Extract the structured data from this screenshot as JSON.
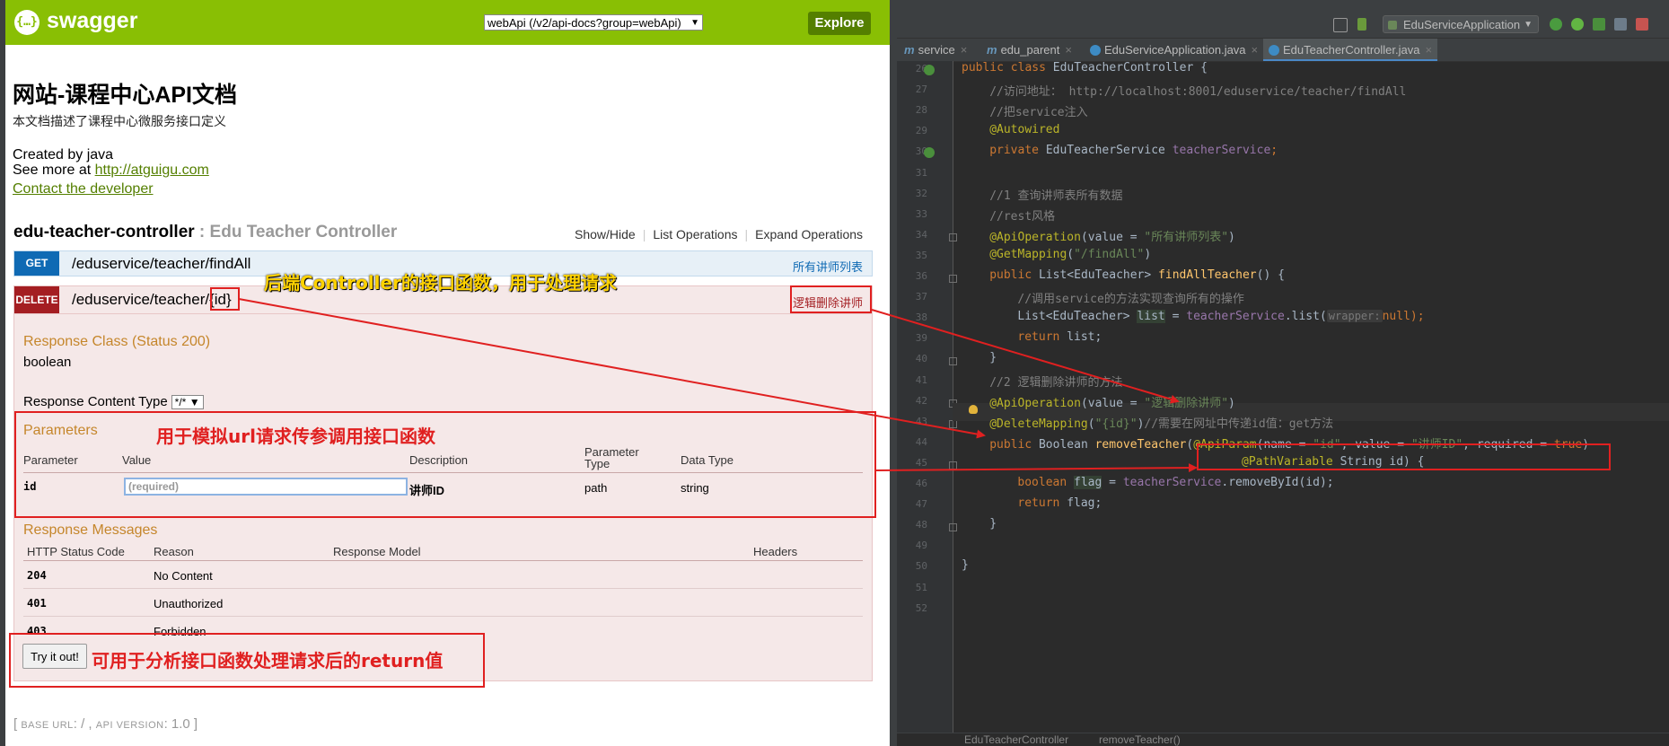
{
  "swagger": {
    "brand": "swagger",
    "logo_text": "{…}",
    "spec_select": "webApi (/v2/api-docs?group=webApi)",
    "explore_label": "Explore",
    "title": "网站-课程中心API文档",
    "description": "本文档描述了课程中心微服务接口定义",
    "created_by": "Created by java",
    "see_more_prefix": "See more at ",
    "see_more_link": "http://atguigu.com",
    "contact": "Contact the developer",
    "controller": {
      "name": "edu-teacher-controller",
      "desc": " : Edu Teacher Controller",
      "links": [
        "Show/Hide",
        "List Operations",
        "Expand Operations"
      ]
    },
    "op_get": {
      "method": "GET",
      "path": "/eduservice/teacher/findAll",
      "summary": "所有讲师列表"
    },
    "op_delete": {
      "method": "DELETE",
      "path_prefix": "/eduservice/teacher/",
      "path_param": "{id}",
      "summary": "逻辑删除讲师",
      "response_class_title": "Response Class (Status 200)",
      "response_class_type": "boolean",
      "response_content_type_label": "Response Content Type",
      "response_content_type_value": "*/*",
      "parameters_title": "Parameters",
      "param_headers": [
        "Parameter",
        "Value",
        "Description",
        "Parameter Type",
        "Data Type"
      ],
      "param_row": {
        "name": "id",
        "placeholder": "(required)",
        "description": "讲师ID",
        "type": "path",
        "data_type": "string"
      },
      "response_messages_title": "Response Messages",
      "msg_headers": [
        "HTTP Status Code",
        "Reason",
        "Response Model",
        "Headers"
      ],
      "msg_rows": [
        {
          "code": "204",
          "reason": "No Content"
        },
        {
          "code": "401",
          "reason": "Unauthorized"
        },
        {
          "code": "403",
          "reason": "Forbidden"
        }
      ],
      "try_label": "Try it out!"
    },
    "base_url_label": "BASE URL",
    "base_url_value": ": / , ",
    "api_version_label": "API VERSION",
    "api_version_value": ": 1.0 ]"
  },
  "annotations": {
    "controller_note": "后端Controller的接口函数，用于处理请求",
    "params_note": "用于模拟url请求传参调用接口函数",
    "try_note": "可用于分析接口函数处理请求后的return值",
    "color": "#e02020",
    "text_color": "#ffd200"
  },
  "ide": {
    "run_config": "EduServiceApplication",
    "tabs": [
      {
        "icon": "m",
        "label": "service"
      },
      {
        "icon": "m",
        "label": "edu_parent"
      },
      {
        "icon": "c",
        "label": "EduServiceApplication.java"
      },
      {
        "icon": "c",
        "label": "EduTeacherController.java"
      }
    ],
    "line_numbers": [
      "26",
      "27",
      "28",
      "29",
      "30",
      "31",
      "32",
      "33",
      "34",
      "35",
      "36",
      "37",
      "38",
      "39",
      "40",
      "41",
      "42",
      "43",
      "44",
      "45",
      "46",
      "47",
      "48",
      "49",
      "50",
      "51",
      "52"
    ],
    "code": {
      "l26_kw": "public class ",
      "l26_name": "EduTeacherController {",
      "l27": "//访问地址： http://localhost:8001/eduservice/teacher/findAll",
      "l28": "//把service注入",
      "l29": "@Autowired",
      "l30_kw": "private ",
      "l30_type": "EduTeacherService ",
      "l30_field": "teacherService",
      "l30_end": ";",
      "l32": "//1 查询讲师表所有数据",
      "l33": "//rest风格",
      "l34_an": "@ApiOperation",
      "l34_a": "(value = ",
      "l34_s": "\"所有讲师列表\"",
      "l34_b": ")",
      "l35_an": "@GetMapping",
      "l35_a": "(",
      "l35_s": "\"/findAll\"",
      "l35_b": ")",
      "l36_kw": "public ",
      "l36_type": "List<EduTeacher> ",
      "l36_fn": "findAllTeacher",
      "l36_end": "() {",
      "l37": "//调用service的方法实现查询所有的操作",
      "l38_a": "List<EduTeacher> ",
      "l38_var": "list",
      "l38_b": " = ",
      "l38_field": "teacherService",
      "l38_c": ".list(",
      "l38_hint": "wrapper:",
      "l38_null": "null",
      "l38_d": ");",
      "l39_kw": "return ",
      "l39_a": "list;",
      "l40": "}",
      "l41": "//2 逻辑删除讲师的方法",
      "l42_an": "@ApiOperation",
      "l42_a": "(value = ",
      "l42_s": "\"逻辑删除讲师\"",
      "l42_b": ")",
      "l43_an": "@DeleteMapping",
      "l43_a": "(",
      "l43_s": "\"{id}\"",
      "l43_b": ")",
      "l43_cm": "//需要在网址中传递id值：get方法",
      "l44_kw": "public ",
      "l44_type": "Boolean ",
      "l44_fn": "removeTeacher",
      "l44_a": "(",
      "l44_an": "@ApiParam",
      "l44_b": "(name = ",
      "l44_s1": "\"id\"",
      "l44_c": ", value = ",
      "l44_s2": "\"讲师ID\"",
      "l44_d": ", required = ",
      "l44_true": "true",
      "l44_e": ")",
      "l45_an": "@PathVariable ",
      "l45_a": "String id) {",
      "l46_kw": "boolean ",
      "l46_var": "flag",
      "l46_a": " = ",
      "l46_field": "teacherService",
      "l46_b": ".removeById(id);",
      "l47_kw": "return ",
      "l47_a": "flag;",
      "l48": "}",
      "l50": "}"
    },
    "breadcrumb": [
      "EduTeacherController",
      "removeTeacher()"
    ]
  }
}
